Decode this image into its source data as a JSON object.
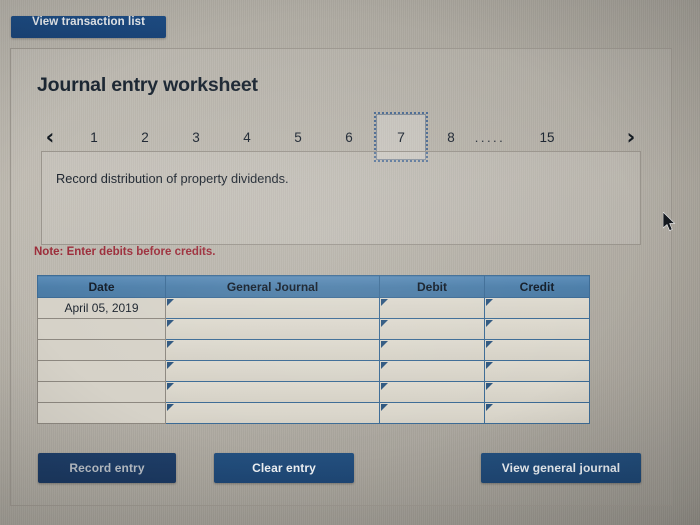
{
  "top_bar": {
    "view_transaction_list_label": "View transaction list"
  },
  "panel": {
    "title": "Journal entry worksheet",
    "pagination": {
      "prev_icon": "chevron-left-icon",
      "next_icon": "chevron-right-icon",
      "prev_glyph": "‹",
      "next_glyph": "›",
      "pages": [
        "1",
        "2",
        "3",
        "4",
        "5",
        "6",
        "7",
        "8",
        ".....",
        "15"
      ],
      "active_page": "7"
    },
    "description": "Record distribution of property dividends.",
    "note": "Note: Enter debits before credits."
  },
  "table": {
    "columns": [
      "Date",
      "General Journal",
      "Debit",
      "Credit"
    ],
    "rows": [
      {
        "date": "April 05, 2019",
        "general_journal": "",
        "debit": "",
        "credit": ""
      },
      {
        "date": "",
        "general_journal": "",
        "debit": "",
        "credit": ""
      },
      {
        "date": "",
        "general_journal": "",
        "debit": "",
        "credit": ""
      },
      {
        "date": "",
        "general_journal": "",
        "debit": "",
        "credit": ""
      },
      {
        "date": "",
        "general_journal": "",
        "debit": "",
        "credit": ""
      },
      {
        "date": "",
        "general_journal": "",
        "debit": "",
        "credit": ""
      }
    ]
  },
  "footer": {
    "record_entry_label": "Record entry",
    "clear_entry_label": "Clear entry",
    "view_general_journal_label": "View general journal"
  },
  "colors": {
    "brand_blue": "#1e4674",
    "header_blue": "#4c7ea9",
    "note_red": "#9b2a38",
    "page_background": "#b2aea5",
    "focus_outline": "#4b6a92"
  },
  "cursor": {
    "icon": "mouse-pointer-icon"
  }
}
